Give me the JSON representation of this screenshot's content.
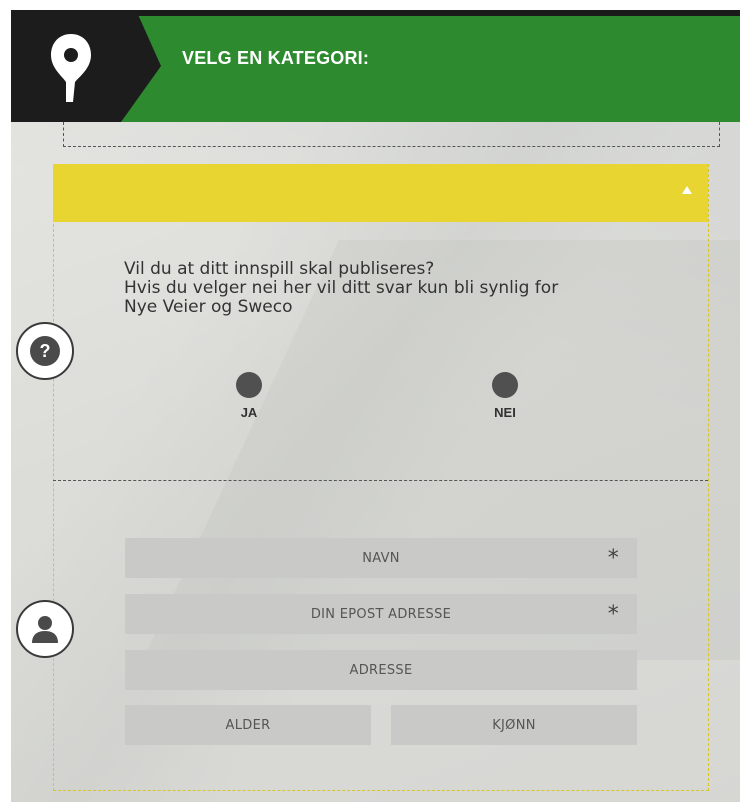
{
  "header": {
    "title": "VELG EN KATEGORI:",
    "color": "#2d8a2f",
    "logo_icon": "map-pin-icon"
  },
  "question_section": {
    "bar_color": "#e8d531",
    "collapse_icon": "triangle-up-icon",
    "side_icon": "question-icon",
    "side_icon_glyph": "?",
    "question_line1": "Vil du at ditt innspill skal publiseres?",
    "question_line2": "Hvis du velger nei her vil ditt svar kun bli synlig for",
    "question_line3": "Nye Veier og Sweco",
    "options": [
      {
        "label": "JA"
      },
      {
        "label": "NEI"
      }
    ]
  },
  "contact_section": {
    "side_icon": "user-icon",
    "fields": {
      "name_placeholder": "NAVN",
      "email_placeholder": "DIN EPOST ADRESSE",
      "address_placeholder": "ADRESSE",
      "age_placeholder": "ALDER",
      "gender_placeholder": "KJØNN",
      "required_marker": "*"
    }
  }
}
